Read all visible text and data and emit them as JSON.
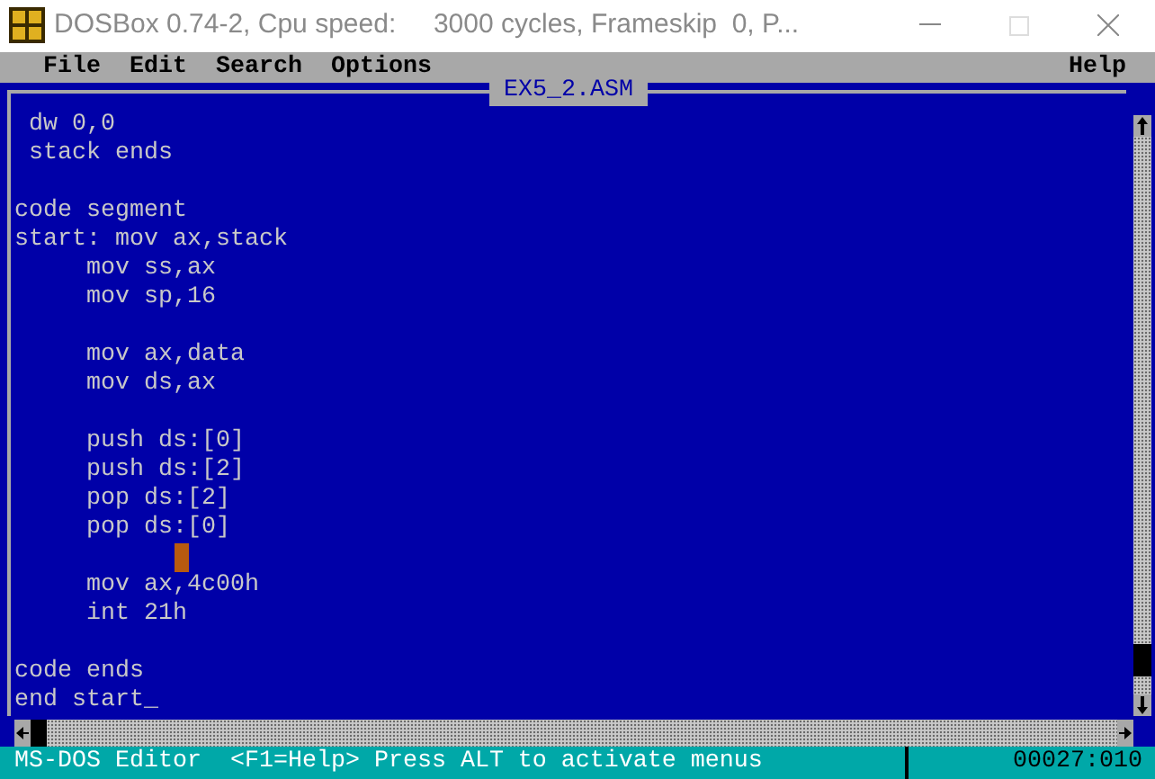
{
  "window": {
    "title": "DOSBox 0.74-2, Cpu speed:     3000 cycles, Frameskip  0, P..."
  },
  "menu": {
    "items": [
      "File",
      "Edit",
      "Search",
      "Options"
    ],
    "help": "Help"
  },
  "editor": {
    "title": "EX5_2.ASM",
    "blocks": [
      [
        " dw 0,0",
        " stack ends"
      ],
      [
        "code segment",
        "start: mov ax,stack",
        "     mov ss,ax",
        "     mov sp,16"
      ],
      [
        "     mov ax,data",
        "     mov ds,ax"
      ],
      [
        "     push ds:[0]",
        "     push ds:[2]",
        "     pop ds:[2]",
        "     pop ds:[0]"
      ],
      [
        "     mov ax,4c00h",
        "     int 21h"
      ],
      [
        "code ends",
        "end start_"
      ]
    ]
  },
  "status_bar": {
    "message": "MS-DOS Editor  <F1=Help> Press ALT to activate menus",
    "position": "00027:010"
  }
}
